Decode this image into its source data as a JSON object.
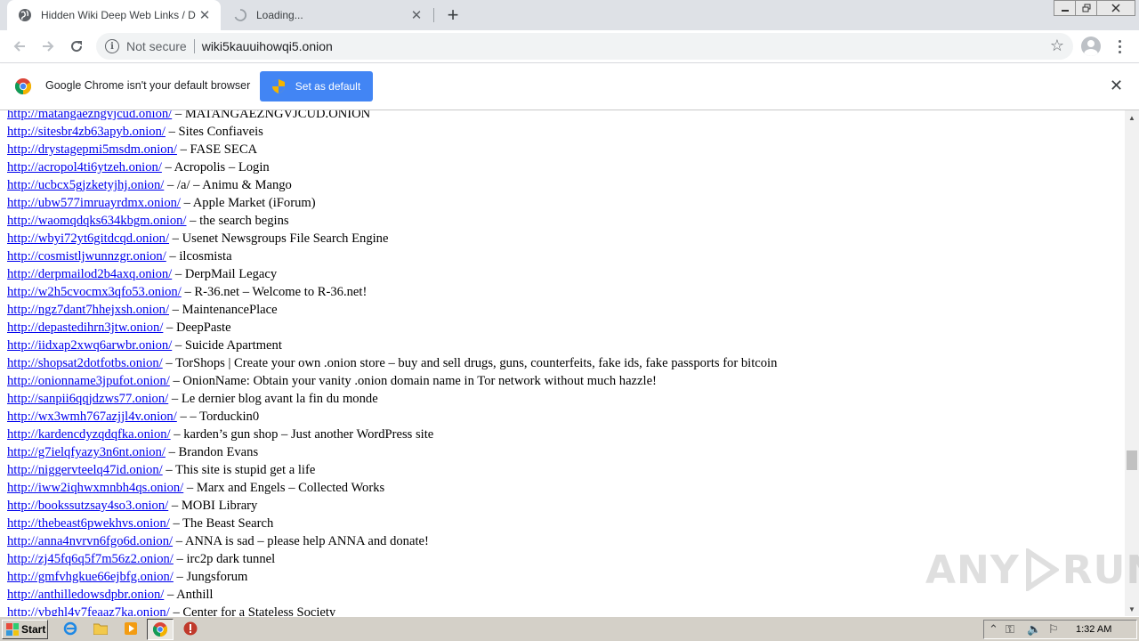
{
  "browser": {
    "tabs": [
      {
        "title": "Hidden Wiki Deep Web Links / Dark W",
        "active": true
      },
      {
        "title": "Loading...",
        "active": false
      }
    ],
    "address": {
      "security_label": "Not secure",
      "url": "wiki5kauuihowqi5.onion"
    }
  },
  "infobar": {
    "message": "Google Chrome isn't your default browser",
    "button_label": "Set as default"
  },
  "page": {
    "lines": [
      {
        "link": "http://matangaezngvjcud.onion/",
        "text": " – MATANGAEZNGVJCUD.ONION"
      },
      {
        "link": "http://sitesbr4zb63apyb.onion/",
        "text": " – Sites Confiaveis"
      },
      {
        "link": "http://drystagepmi5msdm.onion/",
        "text": " – FASE SECA"
      },
      {
        "link": "http://acropol4ti6ytzeh.onion/",
        "text": " – Acropolis – Login"
      },
      {
        "link": "http://ucbcx5gjzketyjhj.onion/",
        "text": " – /a/ – Animu & Mango"
      },
      {
        "link": "http://ubw577imruayrdmx.onion/",
        "text": " – Apple Market (iForum)"
      },
      {
        "link": "http://waomqdqks634kbgm.onion/",
        "text": " – the search begins"
      },
      {
        "link": "http://wbyi72yt6gitdcqd.onion/",
        "text": " – Usenet Newsgroups File Search Engine"
      },
      {
        "link": "http://cosmistljwunnzgr.onion/",
        "text": " – ilcosmista"
      },
      {
        "link": "http://derpmailod2b4axq.onion/",
        "text": " – DerpMail Legacy"
      },
      {
        "link": "http://w2h5cvocmx3qfo53.onion/",
        "text": " – R-36.net – Welcome to R-36.net!"
      },
      {
        "link": "http://ngz7dant7hhejxsh.onion/",
        "text": " – MaintenancePlace"
      },
      {
        "link": "http://depastedihrn3jtw.onion/",
        "text": " – DeepPaste"
      },
      {
        "link": "http://iidxap2xwq6arwbr.onion/",
        "text": " – Suicide Apartment"
      },
      {
        "link": "http://shopsat2dotfotbs.onion/",
        "text": " – TorShops | Create your own .onion store – buy and sell drugs, guns, counterfeits, fake ids, fake passports for bitcoin"
      },
      {
        "link": "http://onionname3jpufot.onion/",
        "text": " – OnionName: Obtain your vanity .onion domain name in Tor network without much hazzle!"
      },
      {
        "link": "http://sanpii6qqjdzws77.onion/",
        "text": " – Le dernier blog avant la fin du monde"
      },
      {
        "link": "http://wx3wmh767azjjl4v.onion/",
        "text": " – – Torduckin0"
      },
      {
        "link": "http://kardencdyzqdqfka.onion/",
        "text": " – karden’s gun shop – Just another WordPress site"
      },
      {
        "link": "http://g7ielqfyazy3n6nt.onion/",
        "text": " – Brandon Evans"
      },
      {
        "link": "http://niggervteelq47id.onion/",
        "text": " – This site is stupid get a life"
      },
      {
        "link": "http://iww2iqhwxmnbh4qs.onion/",
        "text": " – Marx and Engels – Collected Works"
      },
      {
        "link": "http://bookssutzsay4so3.onion/",
        "text": " – MOBI Library"
      },
      {
        "link": "http://thebeast6pwekhvs.onion/",
        "text": " – The Beast Search"
      },
      {
        "link": "http://anna4nvrvn6fgo6d.onion/",
        "text": " – ANNA is sad – please help ANNA and donate!"
      },
      {
        "link": "http://zj45fq6q5f7m56z2.onion/",
        "text": " – irc2p dark tunnel"
      },
      {
        "link": "http://gmfvhgkue66ejbfg.onion/",
        "text": " – Jungsforum"
      },
      {
        "link": "http://anthilledowsdpbr.onion/",
        "text": " – Anthill"
      },
      {
        "link": "http://vbghl4v7feaaz7ka.onion/",
        "text": " – Center for a Stateless Society"
      }
    ]
  },
  "watermark": {
    "left_text": "ANY",
    "right_text": "RUN"
  },
  "taskbar": {
    "start_label": "Start",
    "clock": "1:32 AM"
  },
  "colors": {
    "link": "#0000ee",
    "accent_button": "#4285f4",
    "tab_strip": "#dee1e6",
    "taskbar": "#d4d0c8"
  },
  "icons": [
    "globe-icon",
    "spinner-icon",
    "back-icon",
    "forward-icon",
    "reload-icon",
    "info-icon",
    "star-icon",
    "profile-icon",
    "menu-icon",
    "chrome-logo-icon",
    "shield-icon",
    "close-icon",
    "ie-icon",
    "folder-icon",
    "media-player-icon",
    "chrome-icon",
    "stop-icon"
  ]
}
